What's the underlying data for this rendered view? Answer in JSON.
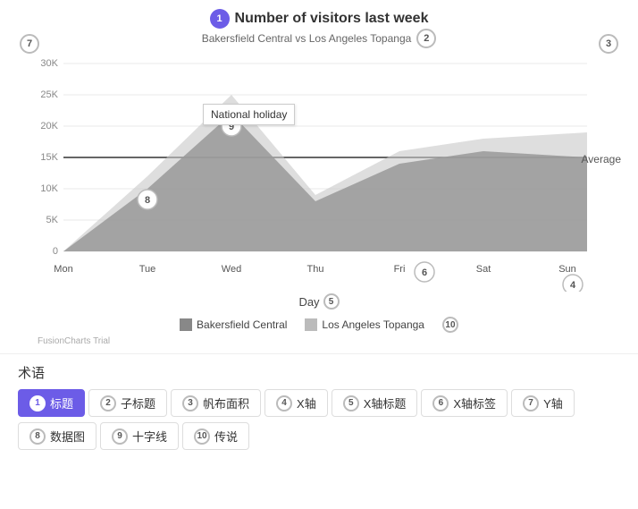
{
  "chart": {
    "title": "Number of visitors last week",
    "subtitle": "Bakersfield Central vs Los Angeles Topanga",
    "average_label": "Average",
    "day_label": "Day",
    "tooltip_text": "National holiday",
    "badge_title": "1",
    "badge_subtitle": "2",
    "badge_7": "7",
    "badge_3": "3",
    "badge_4": "4",
    "badge_5": "5",
    "badge_6": "6",
    "badge_8": "8",
    "badge_9": "9",
    "badge_10": "10",
    "x_labels": [
      "Mon",
      "Tue",
      "Wed",
      "Thu",
      "Fri",
      "Sat",
      "Sun"
    ],
    "y_labels": [
      "30K",
      "25K",
      "20K",
      "15K",
      "10K",
      "5K",
      "0"
    ],
    "series1_color": "#888",
    "series2_color": "#bbb",
    "legend_items": [
      {
        "label": "Bakersfield Central",
        "color": "#888"
      },
      {
        "label": "Los Angeles Topanga",
        "color": "#bbb"
      }
    ]
  },
  "bottom": {
    "section_title": "术语",
    "tags_row1": [
      {
        "num": "1",
        "label": "标题",
        "active": true
      },
      {
        "num": "2",
        "label": "子标题",
        "active": false
      },
      {
        "num": "3",
        "label": "帆布面积",
        "active": false
      },
      {
        "num": "4",
        "label": "X轴",
        "active": false
      },
      {
        "num": "5",
        "label": "X轴标题",
        "active": false
      },
      {
        "num": "6",
        "label": "X轴标签",
        "active": false
      },
      {
        "num": "7",
        "label": "Y轴",
        "active": false
      }
    ],
    "tags_row2": [
      {
        "num": "8",
        "label": "数据图",
        "active": false
      },
      {
        "num": "9",
        "label": "十字线",
        "active": false
      },
      {
        "num": "10",
        "label": "传说",
        "active": false
      }
    ]
  },
  "fusion_trial": "FusionCharts Trial"
}
